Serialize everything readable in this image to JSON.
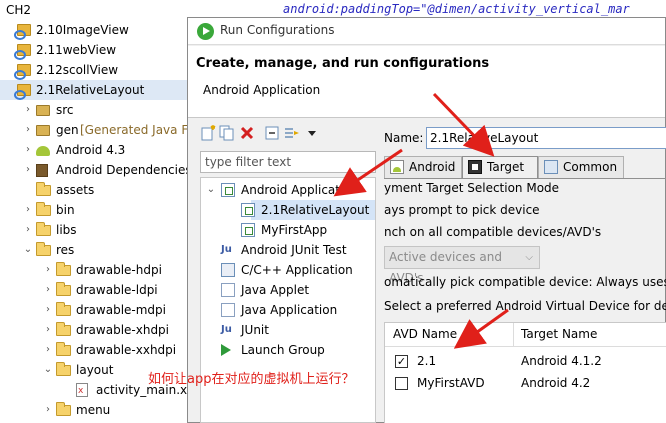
{
  "code_fragment": "android:paddingTop=\"@dimen/activity_vertical_mar",
  "project_tree": {
    "root": "CH2",
    "items": [
      {
        "label": "2.10ImageView",
        "suffix": "",
        "icon": "android-project-icon",
        "depth": 0,
        "twisty": "",
        "selected": false
      },
      {
        "label": "2.11webView",
        "suffix": "",
        "icon": "android-project-icon",
        "depth": 0,
        "twisty": "",
        "selected": false
      },
      {
        "label": "2.12scollView",
        "suffix": "",
        "icon": "android-project-icon",
        "depth": 0,
        "twisty": "",
        "selected": false
      },
      {
        "label": "2.1RelativeLayout",
        "suffix": "",
        "icon": "android-project-icon",
        "depth": 0,
        "twisty": "",
        "selected": true
      },
      {
        "label": "src",
        "suffix": "",
        "icon": "source-folder-icon",
        "depth": 1,
        "twisty": ">",
        "selected": false
      },
      {
        "label": "gen",
        "suffix": "[Generated Java File",
        "icon": "source-folder-icon",
        "depth": 1,
        "twisty": ">",
        "selected": false
      },
      {
        "label": "Android 4.3",
        "suffix": "",
        "icon": "android-lib-icon",
        "depth": 1,
        "twisty": ">",
        "selected": false
      },
      {
        "label": "Android Dependencies",
        "suffix": "",
        "icon": "library-icon",
        "depth": 1,
        "twisty": ">",
        "selected": false
      },
      {
        "label": "assets",
        "suffix": "",
        "icon": "folder-icon",
        "depth": 1,
        "twisty": "",
        "selected": false
      },
      {
        "label": "bin",
        "suffix": "",
        "icon": "folder-icon",
        "depth": 1,
        "twisty": ">",
        "selected": false
      },
      {
        "label": "libs",
        "suffix": "",
        "icon": "folder-icon",
        "depth": 1,
        "twisty": ">",
        "selected": false
      },
      {
        "label": "res",
        "suffix": "",
        "icon": "folder-icon",
        "depth": 1,
        "twisty": "v",
        "selected": false
      },
      {
        "label": "drawable-hdpi",
        "suffix": "",
        "icon": "folder-icon",
        "depth": 2,
        "twisty": ">",
        "selected": false
      },
      {
        "label": "drawable-ldpi",
        "suffix": "",
        "icon": "folder-icon",
        "depth": 2,
        "twisty": ">",
        "selected": false
      },
      {
        "label": "drawable-mdpi",
        "suffix": "",
        "icon": "folder-icon",
        "depth": 2,
        "twisty": ">",
        "selected": false
      },
      {
        "label": "drawable-xhdpi",
        "suffix": "",
        "icon": "folder-icon",
        "depth": 2,
        "twisty": ">",
        "selected": false
      },
      {
        "label": "drawable-xxhdpi",
        "suffix": "",
        "icon": "folder-icon",
        "depth": 2,
        "twisty": ">",
        "selected": false
      },
      {
        "label": "layout",
        "suffix": "",
        "icon": "folder-icon",
        "depth": 2,
        "twisty": "v",
        "selected": false
      },
      {
        "label": "activity_main.xml",
        "suffix": "",
        "icon": "xml-file-icon",
        "depth": 3,
        "twisty": "",
        "selected": false
      },
      {
        "label": "menu",
        "suffix": "",
        "icon": "folder-icon",
        "depth": 2,
        "twisty": ">",
        "selected": false
      }
    ]
  },
  "dialog": {
    "title": "Run Configurations",
    "header_title": "Create, manage, and run configurations",
    "header_subtitle": "Android Application",
    "filter_placeholder": "type filter text",
    "config_tree": [
      {
        "label": "Android Applicat",
        "icon": "config-type-icon",
        "depth": 0,
        "twisty": "v",
        "selected": false
      },
      {
        "label": "2.1RelativeLayout",
        "icon": "config-item-icon",
        "depth": 1,
        "twisty": "",
        "selected": true
      },
      {
        "label": "MyFirstApp",
        "icon": "config-item-icon",
        "depth": 1,
        "twisty": "",
        "selected": false
      },
      {
        "label": "Android JUnit Test",
        "icon": "junit-icon",
        "depth": 0,
        "twisty": "",
        "selected": false
      },
      {
        "label": "C/C++ Application",
        "icon": "cpp-icon",
        "depth": 0,
        "twisty": "",
        "selected": false
      },
      {
        "label": "Java Applet",
        "icon": "applet-icon",
        "depth": 0,
        "twisty": "",
        "selected": false
      },
      {
        "label": "Java Application",
        "icon": "java-app-icon",
        "depth": 0,
        "twisty": "",
        "selected": false
      },
      {
        "label": "JUnit",
        "icon": "junit-icon",
        "depth": 0,
        "twisty": "",
        "selected": false
      },
      {
        "label": "Launch Group",
        "icon": "launch-group-icon",
        "depth": 0,
        "twisty": "",
        "selected": false
      }
    ],
    "name_label": "Name:",
    "name_value": "2.1RelativeLayout",
    "tabs": [
      {
        "label": "Android",
        "active": false
      },
      {
        "label": "Target",
        "active": true
      },
      {
        "label": "Common",
        "active": false
      }
    ],
    "target": {
      "mode_label": "yment Target Selection Mode",
      "always_prompt": "ays prompt to pick device",
      "launch_all": "nch on all compatible devices/AVD's",
      "dropdown_value": "Active devices and AVD's",
      "auto_pick": "omatically pick compatible device: Always uses p",
      "select_preferred": "Select a preferred Android Virtual Device for dep",
      "avd_columns": [
        "AVD Name",
        "Target Name"
      ],
      "avd_rows": [
        {
          "name": "2.1",
          "target": "Android 4.1.2",
          "checked": true
        },
        {
          "name": "MyFirstAVD",
          "target": "Android 4.2",
          "checked": false
        }
      ]
    }
  },
  "annotation": "如何让app在对应的虚拟机上运行？",
  "colors": {
    "annotation_red": "#e0201a",
    "selection": "#dde8f5"
  }
}
